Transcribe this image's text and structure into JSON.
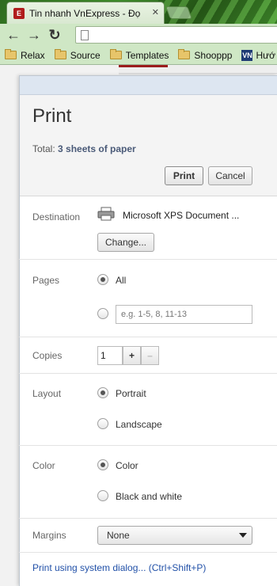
{
  "browser": {
    "tab_title": "Tin nhanh VnExpress - Đọ",
    "tab_close": "✕",
    "favicon_letter": "E",
    "nav": {
      "back": "←",
      "forward": "→",
      "reload": "↻"
    },
    "bookmarks": [
      {
        "label": "Relax"
      },
      {
        "label": "Source"
      },
      {
        "label": "Templates"
      },
      {
        "label": "Shooppp"
      },
      {
        "label": "Hướ"
      }
    ],
    "vn_icon_text": "VN"
  },
  "print": {
    "title": "Print",
    "summary_prefix": "Total: ",
    "summary_value": "3 sheets of paper",
    "print_button": "Print",
    "cancel_button": "Cancel",
    "destination": {
      "label": "Destination",
      "printer_name": "Microsoft XPS Document ...",
      "change_button": "Change..."
    },
    "pages": {
      "label": "Pages",
      "all_label": "All",
      "custom_placeholder": "e.g. 1-5, 8, 11-13"
    },
    "copies": {
      "label": "Copies",
      "value": "1",
      "plus": "+",
      "minus": "–"
    },
    "layout": {
      "label": "Layout",
      "portrait": "Portrait",
      "landscape": "Landscape"
    },
    "color": {
      "label": "Color",
      "color_option": "Color",
      "bw_option": "Black and white"
    },
    "margins": {
      "label": "Margins",
      "selected": "None"
    },
    "system_dialog_link": "Print using system dialog... (Ctrl+Shift+P)"
  },
  "colors": {
    "accent_link": "#2251a8",
    "browser_frame": "#cfe7c5",
    "dialog_topbar": "#dde6f1"
  }
}
